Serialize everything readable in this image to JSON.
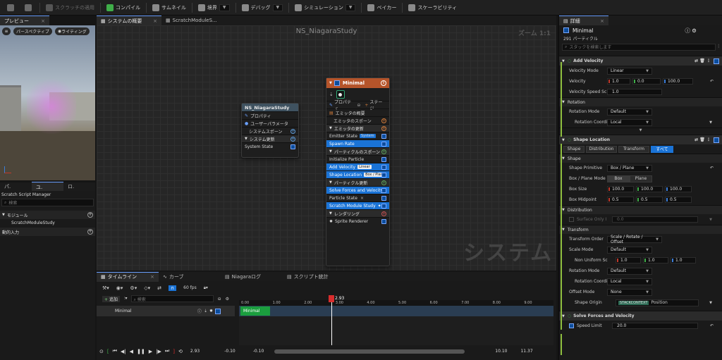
{
  "toolbar": {
    "items": [
      {
        "label": "スクラッチの適用",
        "icon": "apply-scratch-icon"
      },
      {
        "label": "コンパイル",
        "icon": "compile-icon"
      },
      {
        "label": "サムネイル",
        "icon": "thumbnail-icon"
      },
      {
        "label": "境界",
        "icon": "bounds-icon"
      },
      {
        "label": "デバッグ",
        "icon": "debug-icon"
      },
      {
        "label": "シミュレーション",
        "icon": "simulation-icon"
      },
      {
        "label": "ベイカー",
        "icon": "baker-icon"
      },
      {
        "label": "スケーラビリティ",
        "icon": "scalability-icon"
      }
    ]
  },
  "preview": {
    "tab": "プレビュー",
    "perspective": "パースペクティブ",
    "lighting": "ライティング"
  },
  "left_tabs": [
    "パ.",
    "ユ.",
    "ロ."
  ],
  "scratch": {
    "title": "Scratch Script Manager",
    "search_placeholder": "検索",
    "module_section": "モジュール",
    "module_item": "ScratchModuleStudy",
    "dynamic_input": "動的入力"
  },
  "graph_tabs": [
    "システムの概要",
    "ScratchModuleS..."
  ],
  "graph": {
    "title": "NS_NiagaraStudy",
    "zoom": "ズーム 1:1",
    "watermark": "システム"
  },
  "system_node": {
    "title": "NS_NiagaraStudy",
    "rows": [
      "プロパティ",
      "ユーザーパラメータ",
      "システムスポーン",
      "システム更新",
      "System State"
    ]
  },
  "emitter_node": {
    "title": "Minimal",
    "properties": "プロパティ",
    "stage": "ステージ",
    "summary": "エミッタの概要",
    "emitter_spawn": "エミッタのスポーン",
    "emitter_update": "エミッタの更新",
    "emitter_state": "Emitter State",
    "emitter_state_tag": "System",
    "spawn_rate": "Spawn Rate",
    "particle_spawn": "パーティクルのスポーン",
    "initialize": "Initialize Particle",
    "add_velocity": "Add Velocity",
    "add_velocity_tag": "Linear",
    "shape_location": "Shape Location",
    "shape_location_tag": "Box / Plane",
    "particle_update": "パーティクル更新",
    "solve_forces": "Solve Forces and Velocity",
    "particle_state": "Particle State",
    "scratch_module": "Scratch Module Study",
    "render": "レンダリング",
    "sprite_renderer": "Sprite Renderer"
  },
  "timeline": {
    "tabs": [
      "タイムライン",
      "カーブ",
      "Niagaraログ",
      "スクリプト統計"
    ],
    "fps": "60 fps",
    "add": "追加",
    "search_placeholder": "検索",
    "track": "Minimal",
    "bar_label": "Minimal",
    "playhead": "2.93",
    "ticks": [
      "0.00",
      "1.00",
      "2.00",
      "3.00",
      "4.00",
      "5.00",
      "6.00",
      "7.00",
      "8.00",
      "9.00"
    ],
    "current_time": "2.93",
    "range_start": "-0.10",
    "range_start2": "-0.10",
    "range_end": "10.10",
    "range_end2": "11.37"
  },
  "details": {
    "tab": "詳細",
    "emitter": "Minimal",
    "count": "291 パーティクル",
    "search_placeholder": "スタックを検索します",
    "add_velocity": {
      "title": "Add Velocity",
      "mode_label": "Velocity Mode",
      "mode_value": "Linear",
      "velocity_label": "Velocity",
      "velocity": [
        "1.0",
        "0.0",
        "100.0"
      ],
      "speed_label": "Velocity Speed Sc",
      "speed": "1.0",
      "rotation_section": "Rotation",
      "rot_mode_label": "Rotation Mode",
      "rot_mode_value": "Default",
      "rot_coord_label": "Rotation Coordi",
      "rot_coord_value": "Local"
    },
    "shape_location": {
      "title": "Shape Location",
      "tabs": [
        "Shape",
        "Distribution",
        "Transform",
        "すべて"
      ],
      "shape_section": "Shape",
      "primitive_label": "Shape Primitive",
      "primitive_value": "Box / Plane",
      "mode_label": "Box / Plane Mode",
      "mode_options": [
        "Box",
        "Plane"
      ],
      "size_label": "Box Size",
      "size": [
        "100.0",
        "100.0",
        "100.0"
      ],
      "mid_label": "Box Midpoint",
      "mid": [
        "0.5",
        "0.5",
        "0.5"
      ],
      "distribution_section": "Distribution",
      "surface_label": "Surface Only I",
      "surface_value": "0.0",
      "transform_section": "Transform",
      "order_label": "Transform Order",
      "order_value": "Scale / Rotate / Offset",
      "scale_mode_label": "Scale Mode",
      "scale_mode_value": "Default",
      "nonuniform_label": "Non Uniform Sc",
      "nonuniform": [
        "1.0",
        "1.0",
        "1.0"
      ],
      "rot_mode_label": "Rotation Mode",
      "rot_mode_value": "Default",
      "rot_coord_label": "Rotation Coordi",
      "rot_coord_value": "Local",
      "offset_label": "Offset Mode",
      "offset_value": "None",
      "origin_label": "Shape Origin",
      "origin_tag": "STACKCONTEXT",
      "origin_value": "Position"
    },
    "solve_forces": {
      "title": "Solve Forces and Velocity",
      "speed_label": "Speed Limit",
      "speed_value": "20.0"
    }
  }
}
